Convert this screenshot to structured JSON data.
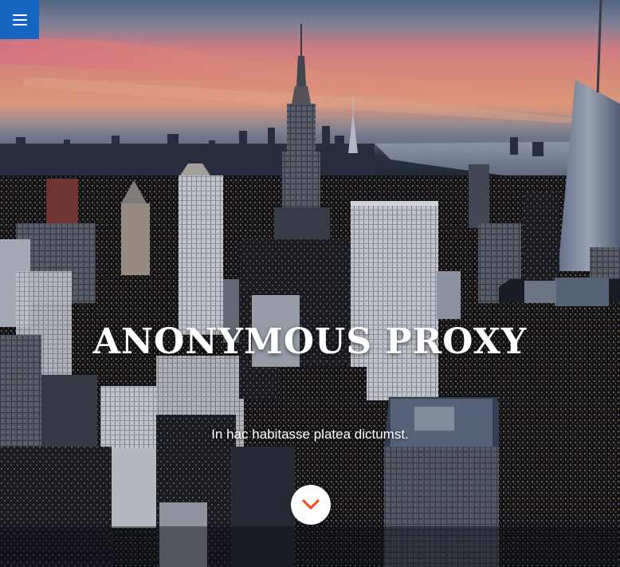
{
  "hero": {
    "title": "ANONYMOUS PROXY",
    "subtitle": "In hac habitasse platea dictumst."
  },
  "menu": {
    "icon": "hamburger-menu-icon"
  },
  "scroll_button": {
    "icon": "chevron-down-icon"
  },
  "colors": {
    "menu_button_bg": "#1565c0",
    "chevron": "#e8541e",
    "text": "#ffffff"
  }
}
